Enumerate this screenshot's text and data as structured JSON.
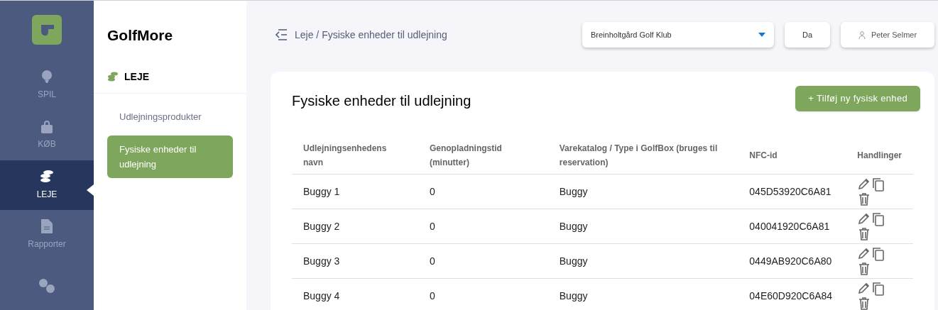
{
  "rail": {
    "items": [
      {
        "label": "SPIL",
        "selected": false
      },
      {
        "label": "KØB",
        "selected": false
      },
      {
        "label": "LEJE",
        "selected": true
      },
      {
        "label": "Rapporter",
        "selected": false
      },
      {
        "selected": false
      }
    ]
  },
  "subnav": {
    "brand": "GolfMore",
    "section": "LEJE",
    "items": [
      {
        "label": "Udlejningsprodukter",
        "selected": false
      },
      {
        "label": "Fysiske enheder til udlejning",
        "selected": true
      }
    ]
  },
  "header": {
    "breadcrumb": "Leje / Fysiske enheder til udlejning",
    "club_select": "Breinholtgård Golf Klub",
    "language": "Da",
    "user": "Peter Selmer"
  },
  "card": {
    "title": "Fysiske enheder til udlejning",
    "add_button": "+ Tilføj ny fysisk enhed",
    "table": {
      "columns": [
        "Udlejningsenhedens navn",
        "Genopladningstid (minutter)",
        "Varekatalog / Type i GolfBox (bruges til reservation)",
        "NFC-id",
        "Handlinger"
      ],
      "rows": [
        {
          "name": "Buggy 1",
          "recharge": "0",
          "type": "Buggy",
          "nfc": "045D53920C6A81"
        },
        {
          "name": "Buggy 2",
          "recharge": "0",
          "type": "Buggy",
          "nfc": "040041920C6A81"
        },
        {
          "name": "Buggy 3",
          "recharge": "0",
          "type": "Buggy",
          "nfc": "0449AB920C6A80"
        },
        {
          "name": "Buggy 4",
          "recharge": "0",
          "type": "Buggy",
          "nfc": "04E60D920C6A84"
        }
      ]
    }
  }
}
